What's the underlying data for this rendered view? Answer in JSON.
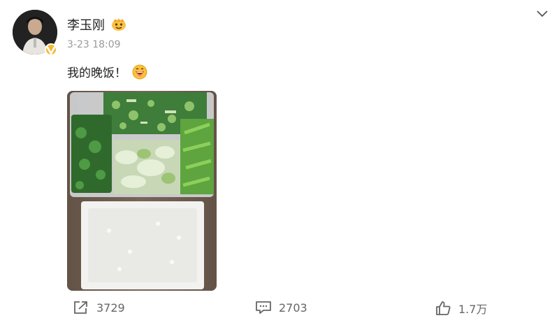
{
  "post": {
    "username": "李玉刚",
    "timestamp": "3-23 18:09",
    "text": "我的晚饭！",
    "emoji": "grinning-face-icon",
    "image_description": "meal-photo"
  },
  "actions": {
    "share_count": "3729",
    "comment_count": "2703",
    "like_count": "1.7万"
  },
  "icons": {
    "share": "share-icon",
    "comment": "comment-icon",
    "like": "thumbs-up-icon",
    "more": "chevron-down-icon",
    "verified": "verified-badge-icon",
    "member": "member-badge-icon"
  },
  "colors": {
    "verified": "#f5b82e",
    "muted_text": "#9a9a9a",
    "count_text": "#666666"
  }
}
